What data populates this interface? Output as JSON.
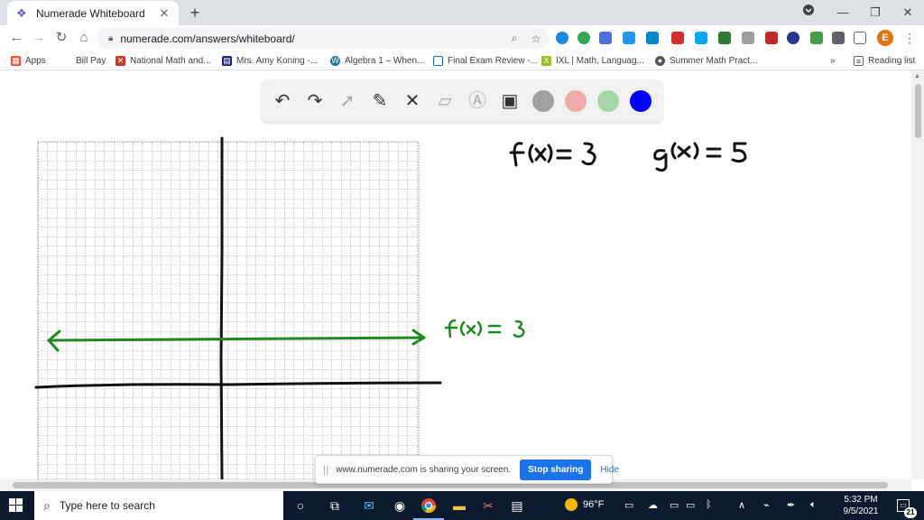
{
  "browser": {
    "tab_title": "Numerade Whiteboard",
    "url": "numerade.com/answers/whiteboard/",
    "profile_initial": "E"
  },
  "bookmarks": {
    "items": [
      {
        "label": "Apps",
        "icon": "apps-grid-icon",
        "color": "#e74c3c"
      },
      {
        "label": "Bill Pay",
        "icon": "bill-pay-icon",
        "color": "#1e88e5"
      },
      {
        "label": "National Math and...",
        "icon": "national-math-icon",
        "color": "#c0392b"
      },
      {
        "label": "Mrs. Amy Koning -...",
        "icon": "classroom-icon",
        "color": "#1a237e"
      },
      {
        "label": "Algebra 1 – When...",
        "icon": "wordpress-icon",
        "color": "#21759b"
      },
      {
        "label": "Final Exam Review -...",
        "icon": "document-icon",
        "color": "#1565c0"
      },
      {
        "label": "IXL | Math, Languag...",
        "icon": "ixl-icon",
        "color": "#9bbb2c"
      },
      {
        "label": "Summer Math Pract...",
        "icon": "summer-math-icon",
        "color": "#555555"
      }
    ],
    "reading_list": "Reading list"
  },
  "whiteboard": {
    "tools": [
      "undo-icon",
      "redo-icon",
      "pointer-icon",
      "pen-icon",
      "tools-icon",
      "eraser-icon",
      "text-icon",
      "image-icon"
    ],
    "colors": [
      "#a0a0a0",
      "#f0aaaa",
      "#a6d6a6",
      "#0000ff"
    ],
    "handwriting": {
      "eq1": "f(x) = 3",
      "eq2": "g(x) = 5",
      "line_label": "f(x) = 3"
    }
  },
  "sharing": {
    "message": "www.numerade.com is sharing your screen.",
    "stop_label": "Stop sharing",
    "hide_label": "Hide"
  },
  "taskbar": {
    "search_placeholder": "Type here to search",
    "temperature": "96°F",
    "time": "5:32 PM",
    "date": "9/5/2021",
    "notification_count": "21"
  }
}
